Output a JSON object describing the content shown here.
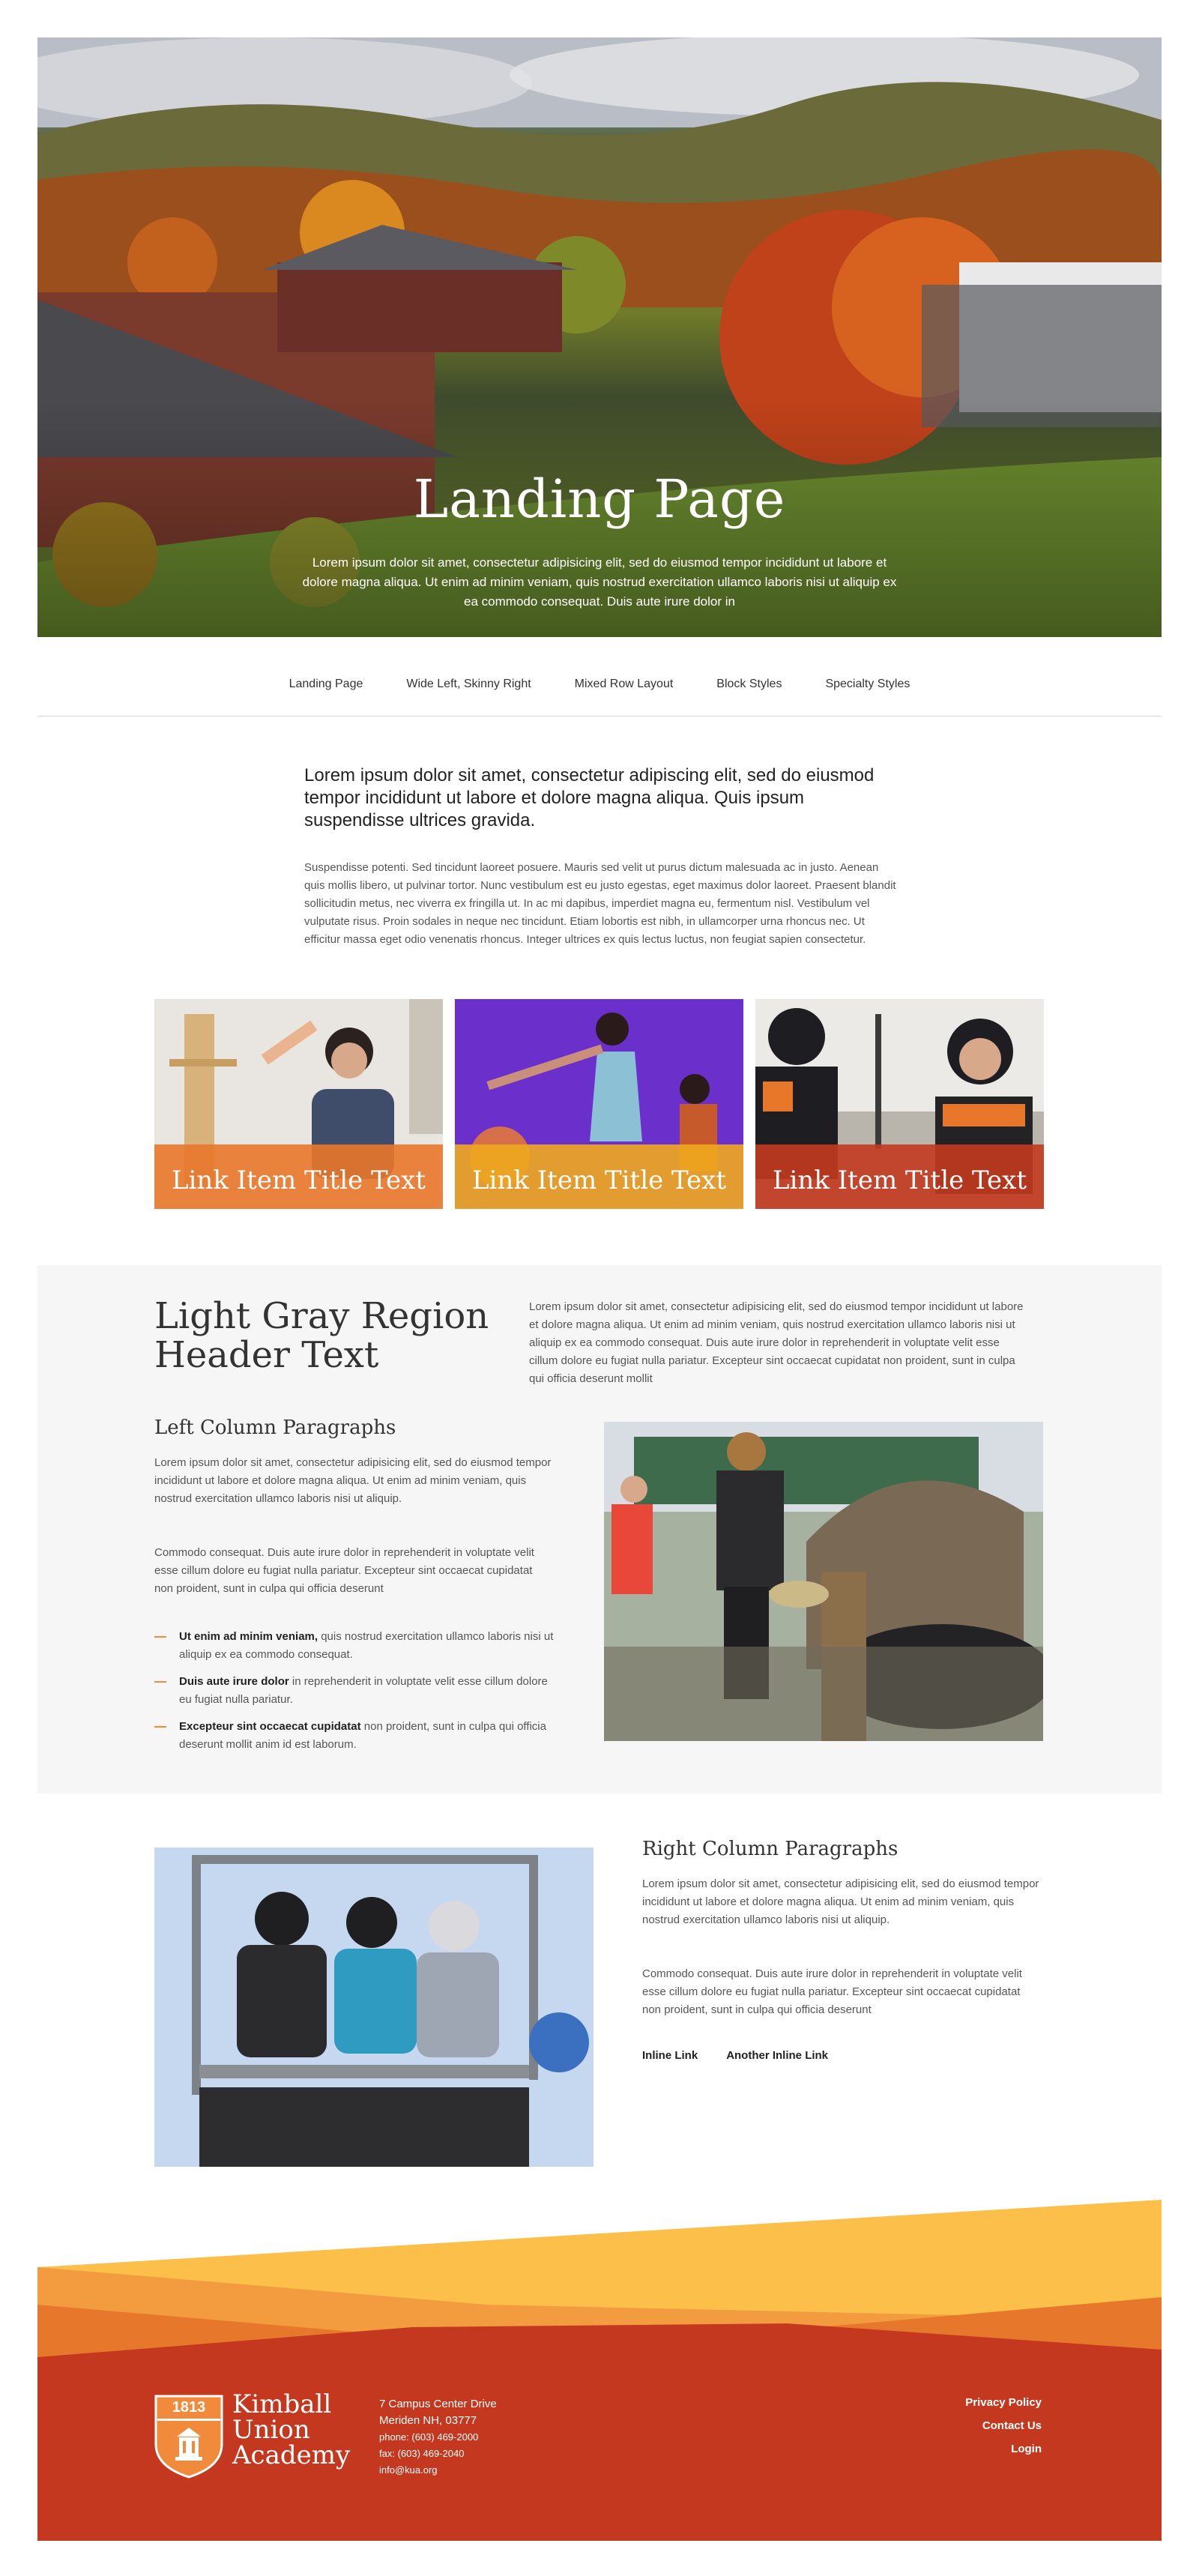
{
  "hero": {
    "title": "Landing Page",
    "intro": "Lorem ipsum dolor sit amet, consectetur adipisicing elit, sed do eiusmod tempor incididunt ut labore et dolore magna aliqua. Ut enim ad minim veniam, quis nostrud exercitation ullamco laboris nisi ut aliquip ex ea commodo consequat. Duis aute irure dolor in"
  },
  "subnav": {
    "items": [
      {
        "label": "Landing Page",
        "active": true
      },
      {
        "label": "Wide Left, Skinny Right",
        "active": false
      },
      {
        "label": "Mixed Row Layout",
        "active": false
      },
      {
        "label": "Block Styles",
        "active": false
      },
      {
        "label": "Specialty Styles",
        "active": false
      }
    ]
  },
  "intro": {
    "lead": "Lorem ipsum dolor sit amet, consectetur adipiscing elit, sed do eiusmod tempor incididunt ut labore et dolore magna aliqua. Quis ipsum suspendisse ultrices gravida.",
    "body": "Suspendisse potenti. Sed tincidunt laoreet posuere. Mauris sed velit ut purus dictum malesuada ac in justo. Aenean quis mollis libero, ut pulvinar tortor. Nunc vestibulum est eu justo egestas, eget maximus dolor laoreet. Praesent blandit sollicitudin metus, nec viverra ex fringilla ut. In ac mi dapibus, imperdiet magna eu, fermentum nisl. Vestibulum vel vulputate risus. Proin sodales in neque nec tincidunt. Etiam lobortis est nibh, in ullamcorper urna rhoncus nec. Ut efficitur massa eget odio venenatis rhoncus. Integer ultrices ex quis lectus luctus, non feugiat sapien consectetur."
  },
  "cards": [
    {
      "title": "Link Item Title Text",
      "color": "#e8772a"
    },
    {
      "title": "Link Item Title Text",
      "color": "#f0a81e"
    },
    {
      "title": "Link Item Title Text",
      "color": "#c3381f"
    }
  ],
  "gray_region": {
    "header": "Light Gray Region Header Text",
    "intro": "Lorem ipsum dolor sit amet, consectetur adipisicing elit, sed do eiusmod tempor incididunt ut labore et dolore magna aliqua. Ut enim ad minim veniam, quis nostrud exercitation ullamco laboris nisi ut aliquip ex ea commodo consequat. Duis aute irure dolor in reprehenderit in voluptate velit esse cillum dolore eu fugiat nulla pariatur. Excepteur sint occaecat cupidatat non proident, sunt in culpa qui officia deserunt mollit",
    "left_heading": "Left Column Paragraphs",
    "left_p1": "Lorem ipsum dolor sit amet, consectetur adipisicing elit, sed do eiusmod tempor incididunt ut labore et dolore magna aliqua. Ut enim ad minim veniam, quis nostrud exercitation ullamco laboris nisi ut aliquip.",
    "left_p2": "Commodo consequat. Duis aute irure dolor in reprehenderit in voluptate velit esse cillum dolore eu fugiat nulla pariatur. Excepteur sint occaecat cupidatat non proident, sunt in culpa qui officia deserunt",
    "bullets": [
      {
        "bold": "Ut enim ad minim veniam,",
        "text": " quis nostrud exercitation ullamco laboris nisi ut aliquip ex ea commodo consequat."
      },
      {
        "bold": "Duis aute irure dolor",
        "text": " in reprehenderit in voluptate velit esse cillum dolore eu fugiat nulla pariatur."
      },
      {
        "bold": "Excepteur sint occaecat cupidatat",
        "text": " non proident, sunt in culpa qui officia deserunt mollit anim id est laborum."
      }
    ]
  },
  "right_column": {
    "heading": "Right Column Paragraphs",
    "p1": "Lorem ipsum dolor sit amet, consectetur adipisicing elit, sed do eiusmod tempor incididunt ut labore et dolore magna aliqua. Ut enim ad minim veniam, quis nostrud exercitation ullamco laboris nisi ut aliquip.",
    "p2": "Commodo consequat. Duis aute irure dolor in reprehenderit in voluptate velit esse cillum dolore eu fugiat nulla pariatur. Excepteur sint occaecat cupidatat non proident, sunt in culpa qui officia deserunt",
    "links": [
      "Inline Link",
      "Another Inline Link"
    ]
  },
  "footer": {
    "logo_year": "1813",
    "logo_line1": "Kimball",
    "logo_line2": "Union",
    "logo_line3": "Academy",
    "address1": "7 Campus Center Drive",
    "address2": "Meriden NH, 03777",
    "phone": "phone: (603) 469-2000",
    "fax": "fax: (603) 469-2040",
    "email": "info@kua.org",
    "links": [
      "Privacy Policy",
      "Contact Us",
      "Login"
    ]
  },
  "colors": {
    "accent_orange": "#f28a3c",
    "footer_red": "#c3381f",
    "footer_yellow": "#fbbf4a"
  }
}
